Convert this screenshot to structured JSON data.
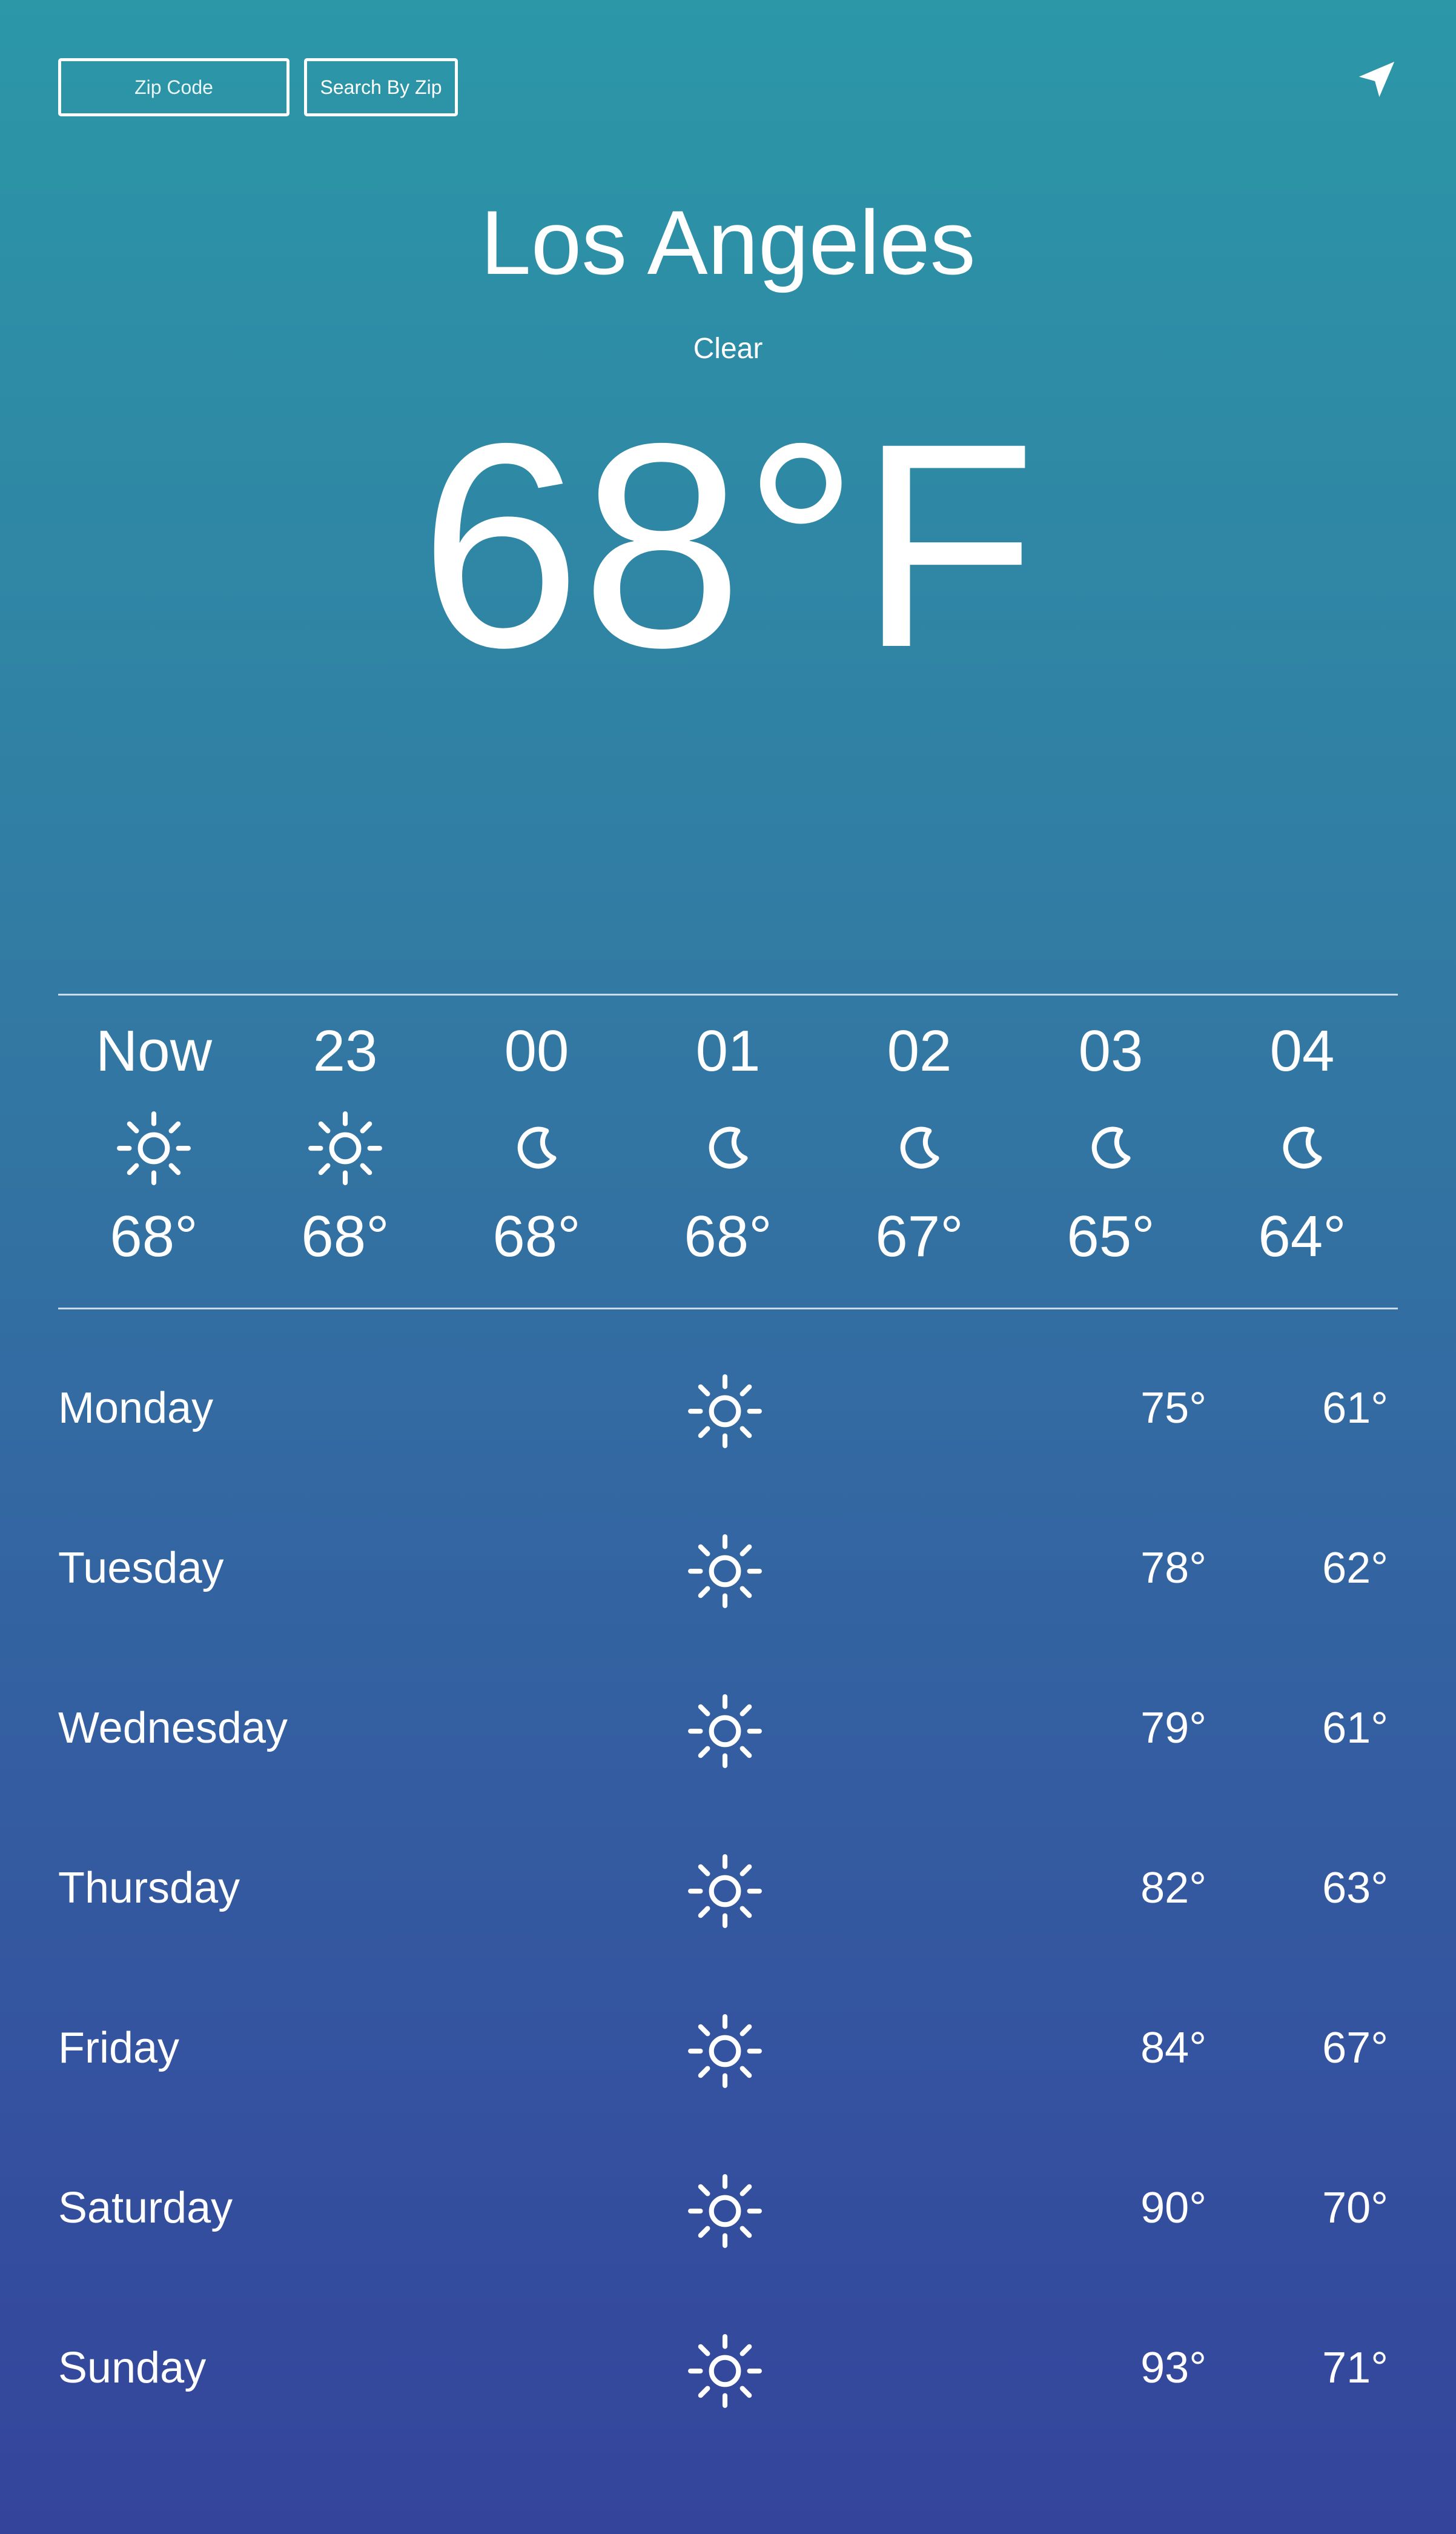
{
  "search": {
    "placeholder": "Zip Code",
    "button_label": "Search By Zip"
  },
  "location": {
    "city": "Los Angeles",
    "condition": "Clear",
    "temperature": "68°F"
  },
  "hourly": [
    {
      "label": "Now",
      "icon": "sun-icon",
      "temp": "68°"
    },
    {
      "label": "23",
      "icon": "sun-icon",
      "temp": "68°"
    },
    {
      "label": "00",
      "icon": "moon-icon",
      "temp": "68°"
    },
    {
      "label": "01",
      "icon": "moon-icon",
      "temp": "68°"
    },
    {
      "label": "02",
      "icon": "moon-icon",
      "temp": "67°"
    },
    {
      "label": "03",
      "icon": "moon-icon",
      "temp": "65°"
    },
    {
      "label": "04",
      "icon": "moon-icon",
      "temp": "64°"
    }
  ],
  "daily": [
    {
      "day": "Monday",
      "icon": "sun-icon",
      "high": "75°",
      "low": "61°"
    },
    {
      "day": "Tuesday",
      "icon": "sun-icon",
      "high": "78°",
      "low": "62°"
    },
    {
      "day": "Wednesday",
      "icon": "sun-icon",
      "high": "79°",
      "low": "61°"
    },
    {
      "day": "Thursday",
      "icon": "sun-icon",
      "high": "82°",
      "low": "63°"
    },
    {
      "day": "Friday",
      "icon": "sun-icon",
      "high": "84°",
      "low": "67°"
    },
    {
      "day": "Saturday",
      "icon": "sun-icon",
      "high": "90°",
      "low": "70°"
    },
    {
      "day": "Sunday",
      "icon": "sun-icon",
      "high": "93°",
      "low": "71°"
    }
  ],
  "colors": {
    "gradient_top": "#2b97a7",
    "gradient_bottom": "#34449b",
    "text": "#ffffff"
  }
}
